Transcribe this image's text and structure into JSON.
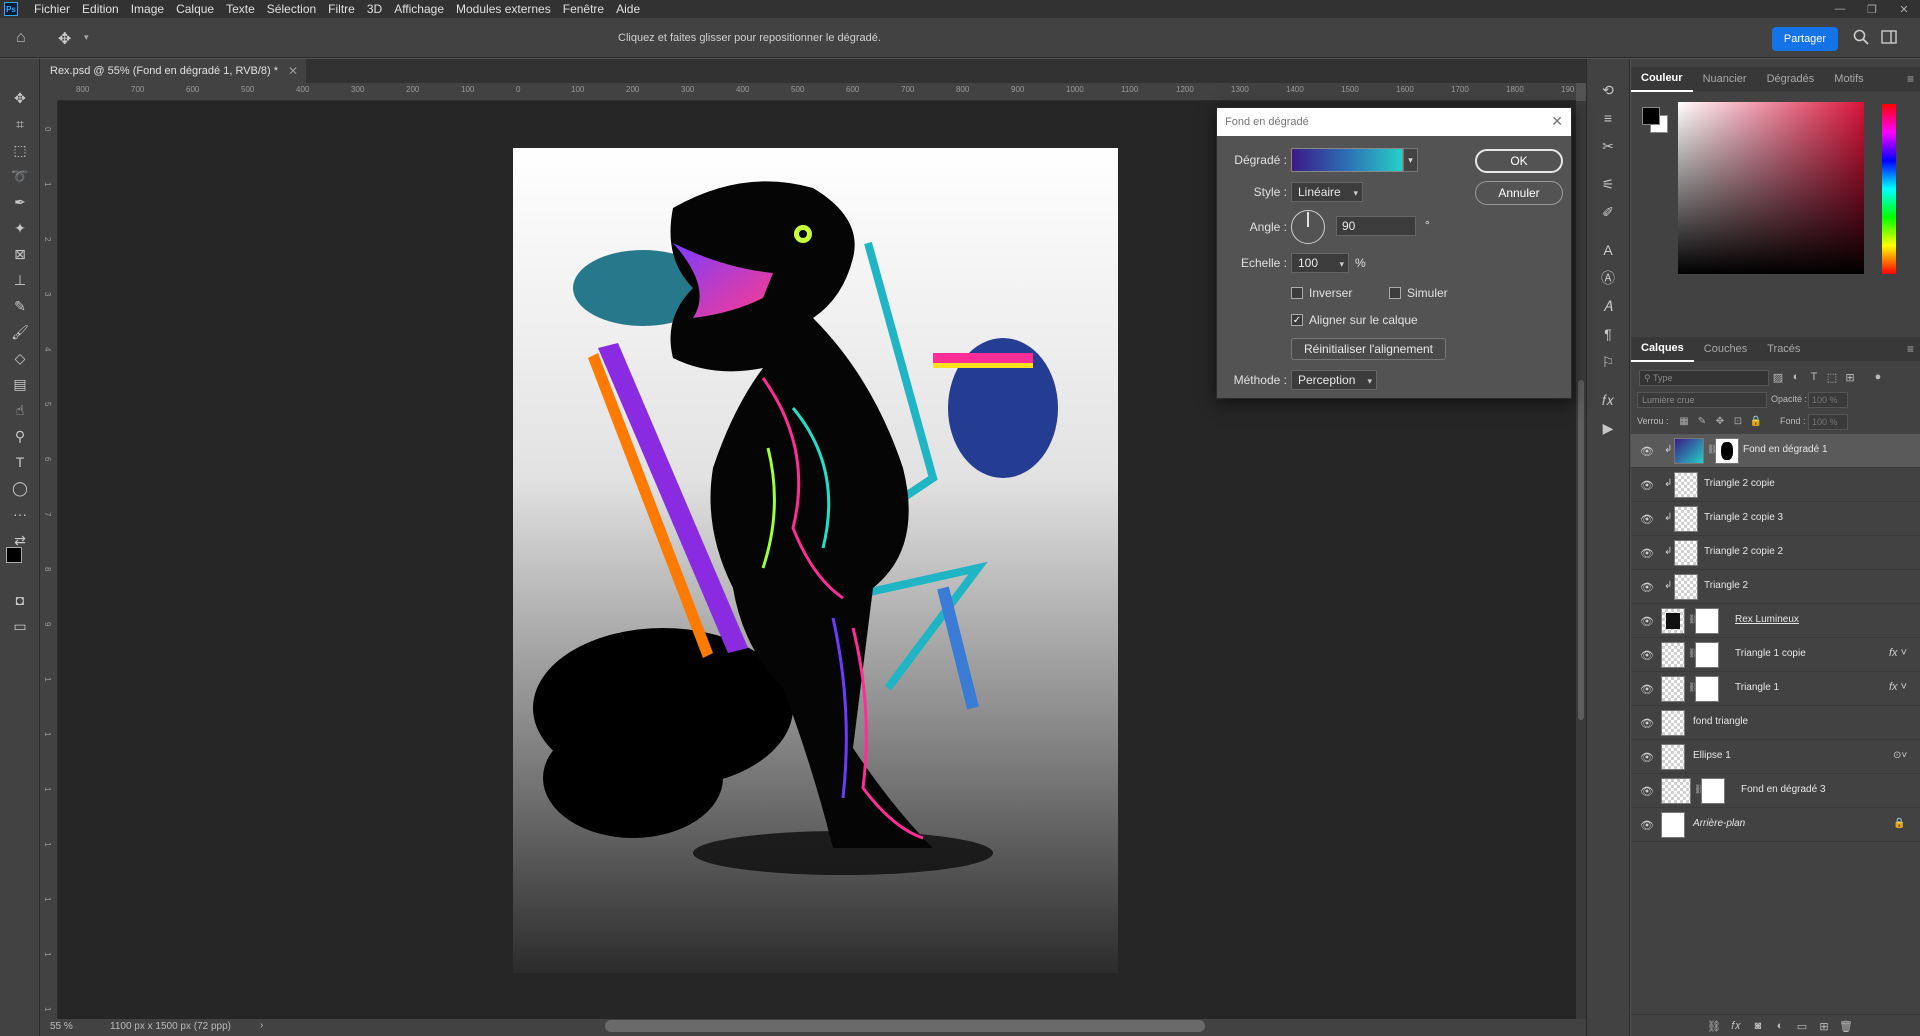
{
  "menu": {
    "items": [
      "Fichier",
      "Edition",
      "Image",
      "Calque",
      "Texte",
      "Sélection",
      "Filtre",
      "3D",
      "Affichage",
      "Modules externes",
      "Fenêtre",
      "Aide"
    ]
  },
  "options": {
    "hint": "Cliquez et faites glisser pour repositionner le dégradé.",
    "share_label": "Partager"
  },
  "document": {
    "tab_title": "Rex.psd @ 55% (Fond en dégradé 1, RVB/8) *",
    "zoom": "55 %",
    "size": "1100 px x 1500 px (72 ppp)"
  },
  "ruler": {
    "h_labels": [
      "800",
      "700",
      "600",
      "500",
      "400",
      "300",
      "200",
      "100",
      "0",
      "100",
      "200",
      "300",
      "400",
      "500",
      "600",
      "700",
      "800",
      "900",
      "1000",
      "1100",
      "1200",
      "1300",
      "1400",
      "1500",
      "1600",
      "1700",
      "1800",
      "190"
    ],
    "v_labels": [
      "0",
      "1",
      "2",
      "3",
      "4",
      "5",
      "6",
      "7",
      "8",
      "9",
      "1",
      "1",
      "1",
      "1",
      "1",
      "1",
      "1"
    ]
  },
  "color_panel": {
    "tabs": [
      "Couleur",
      "Nuancier",
      "Dégradés",
      "Motifs"
    ],
    "foreground": "#000000",
    "background": "#ffffff",
    "field_hue": "#d8133a"
  },
  "layers_panel": {
    "tabs": [
      "Calques",
      "Couches",
      "Tracés"
    ],
    "search_placeholder": "Type",
    "blend_mode": "Lumière crue",
    "opacity_label": "Opacité :",
    "opacity_value": "100 %",
    "lock_label": "Verrou :",
    "fill_label": "Fond :",
    "fill_value": "100 %",
    "layers": [
      {
        "name": "Fond en dégradé 1",
        "selected": true,
        "clipped": true,
        "fx": false
      },
      {
        "name": "Triangle 2 copie",
        "selected": false,
        "clipped": true,
        "fx": false
      },
      {
        "name": "Triangle 2 copie 3",
        "selected": false,
        "clipped": true,
        "fx": false
      },
      {
        "name": "Triangle 2 copie 2",
        "selected": false,
        "clipped": true,
        "fx": false
      },
      {
        "name": "Triangle 2",
        "selected": false,
        "clipped": true,
        "fx": false
      },
      {
        "name": "Rex Lumineux",
        "selected": false,
        "clipped": false,
        "fx": false
      },
      {
        "name": "Triangle 1 copie",
        "selected": false,
        "clipped": false,
        "fx": true
      },
      {
        "name": "Triangle 1",
        "selected": false,
        "clipped": false,
        "fx": true
      },
      {
        "name": "fond triangle",
        "selected": false,
        "clipped": false,
        "fx": false
      },
      {
        "name": "Ellipse 1",
        "selected": false,
        "clipped": false,
        "fx": false
      },
      {
        "name": "Fond en dégradé 3",
        "selected": false,
        "clipped": false,
        "fx": false
      },
      {
        "name": "Arrière-plan",
        "selected": false,
        "clipped": false,
        "fx": false
      }
    ]
  },
  "dialog": {
    "title": "Fond en dégradé",
    "gradient_label": "Dégradé :",
    "style_label": "Style :",
    "style_value": "Linéaire",
    "angle_label": "Angle :",
    "angle_value": "90",
    "angle_unit": "°",
    "scale_label": "Echelle :",
    "scale_value": "100",
    "scale_unit": "%",
    "reverse_label": "Inverser",
    "dither_label": "Simuler",
    "align_label": "Aligner sur le calque",
    "align_checked": true,
    "reset_label": "Réinitialiser l'alignement",
    "method_label": "Méthode :",
    "method_value": "Perception",
    "ok_label": "OK",
    "cancel_label": "Annuler"
  },
  "colors": {
    "accent": "#1473e6",
    "gradient_start": "#3b1a86",
    "gradient_end": "#25d0c8"
  }
}
